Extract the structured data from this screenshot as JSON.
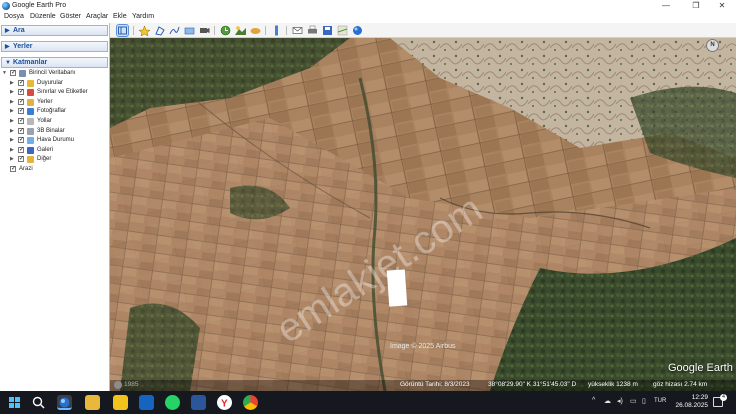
{
  "window": {
    "title": "Google Earth Pro",
    "controls": [
      "—",
      "❐",
      "✕"
    ]
  },
  "menu": [
    "Dosya",
    "Düzenle",
    "Göster",
    "Araçlar",
    "Ekle",
    "Yardım"
  ],
  "panels": {
    "search": "Ara",
    "places": "Yerler",
    "layers": "Katmanlar"
  },
  "layers": [
    {
      "label": "Birincil Veritabanı",
      "checked": true,
      "icon": "globe-layer-icon",
      "color": "#7a8fb0",
      "depth": 0
    },
    {
      "label": "Duyurular",
      "checked": true,
      "icon": "announcement-icon",
      "color": "#e7b73a",
      "depth": 1
    },
    {
      "label": "Sınırlar ve Etiketler",
      "checked": true,
      "icon": "borders-icon",
      "color": "#d84c3f",
      "depth": 1
    },
    {
      "label": "Yerler",
      "checked": true,
      "icon": "places-icon",
      "color": "#e2b23c",
      "depth": 1
    },
    {
      "label": "Fotoğraflar",
      "checked": true,
      "icon": "photos-icon",
      "color": "#3c7fd0",
      "depth": 1
    },
    {
      "label": "Yollar",
      "checked": true,
      "icon": "roads-icon",
      "color": "#b8b8b8",
      "depth": 1
    },
    {
      "label": "3B Binalar",
      "checked": true,
      "icon": "buildings-icon",
      "color": "#9aa3ad",
      "depth": 1
    },
    {
      "label": "Hava Durumu",
      "checked": true,
      "icon": "weather-icon",
      "color": "#6fb0e6",
      "depth": 1
    },
    {
      "label": "Galeri",
      "checked": true,
      "icon": "gallery-icon",
      "color": "#3b66c2",
      "depth": 1
    },
    {
      "label": "Diğer",
      "checked": true,
      "icon": "other-icon",
      "color": "#e3b53f",
      "depth": 1
    },
    {
      "label": "Arazi",
      "checked": true,
      "icon": "",
      "color": "",
      "depth": 0
    }
  ],
  "map": {
    "watermark": "emlakjet.com",
    "imagery_credit": "Image © 2025 Airbus",
    "logo": "Google Earth",
    "compass": "N",
    "history_year": "1985"
  },
  "status": {
    "date": "Görüntü Tarihi: 8/3/2023",
    "coords": "38°08'29.90\" K   31°51'45.03\" D",
    "elevation": "yükseklik  1238 m",
    "eye_alt": "göz hizası   2.74 km"
  },
  "taskbar": {
    "time": "12:29",
    "date": "26.08.2025",
    "lang": "TUR",
    "notifications": "4"
  }
}
